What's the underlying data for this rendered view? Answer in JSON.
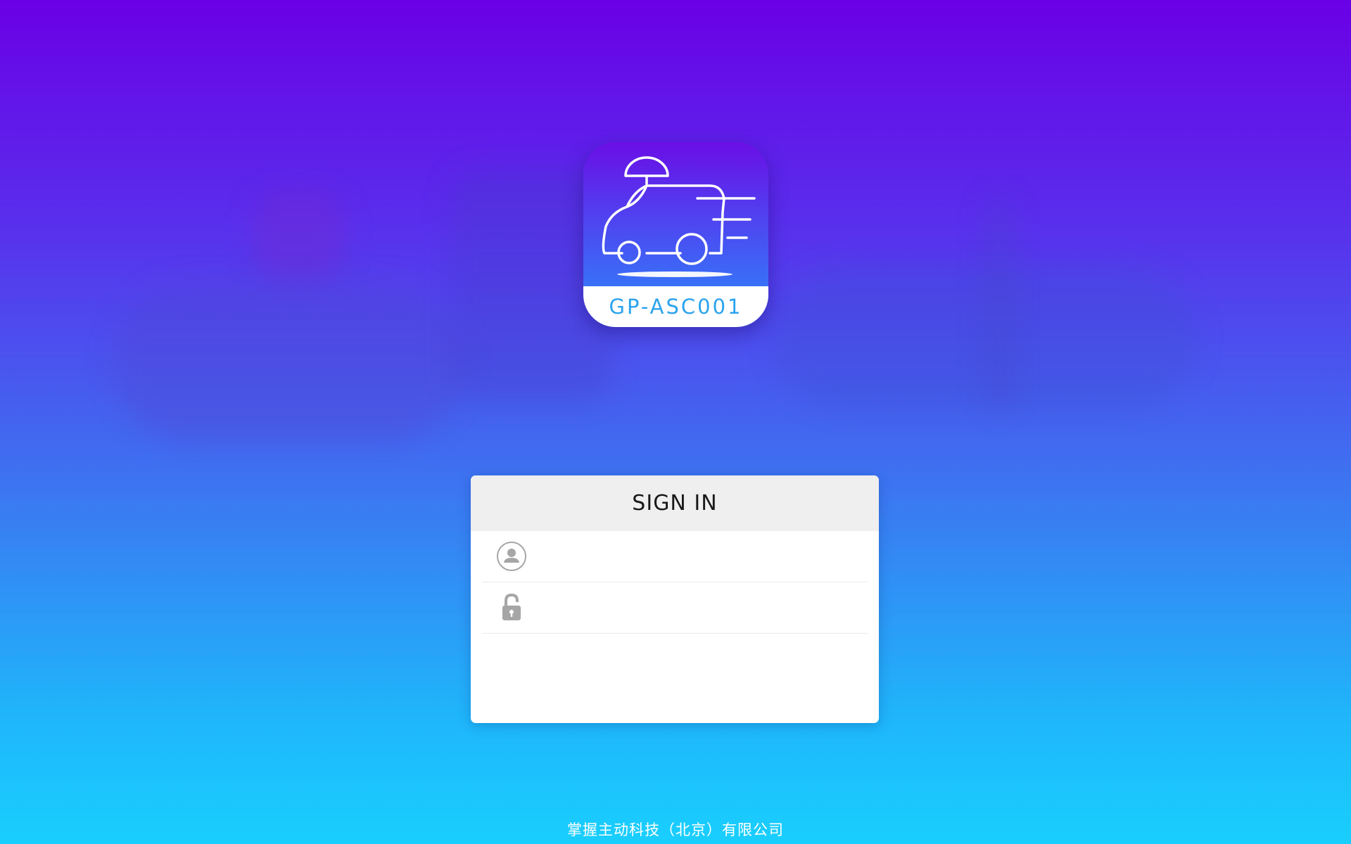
{
  "app": {
    "icon_label": "GP-ASC001",
    "icon_name": "delivery-robot-van-icon"
  },
  "login": {
    "title": "SIGN IN",
    "username": {
      "icon": "user-icon",
      "value": "",
      "placeholder": ""
    },
    "password": {
      "icon": "lock-icon",
      "value": "",
      "placeholder": ""
    }
  },
  "footer": {
    "company": "掌握主动科技（北京）有限公司"
  },
  "colors": {
    "gradient_top": "#6a00e6",
    "gradient_bottom": "#19cffe",
    "icon_label_text": "#2aa3ee",
    "field_icon": "#a6a6a6"
  }
}
